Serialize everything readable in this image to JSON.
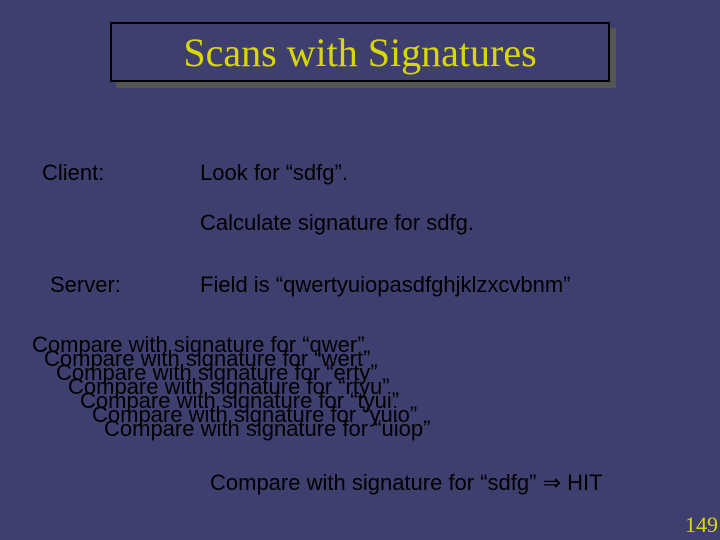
{
  "title": "Scans with Signatures",
  "client_label": "Client:",
  "client_line1": "Look for “sdfg”.",
  "client_line2": "Calculate signature for sdfg.",
  "server_label": "Server:",
  "server_line1": "Field is “qwertyuiopasdfghjklzxcvbnm”",
  "cascade": {
    "c1": "Compare with signature for “qwer”",
    "c2": "Compare with signature for “wert”",
    "c3": "Compare with signature for “erty”",
    "c4": "Compare with signature for “rtyu”",
    "c5": "Compare with signature for “tyui”",
    "c6": "Compare with signature for “yuio”",
    "c7": "Compare with signature for “uiop”"
  },
  "hit_prefix": "Compare with signature for “sdfg” ",
  "hit_arrow": "⇒",
  "hit_suffix": " HIT",
  "page_number": "149"
}
